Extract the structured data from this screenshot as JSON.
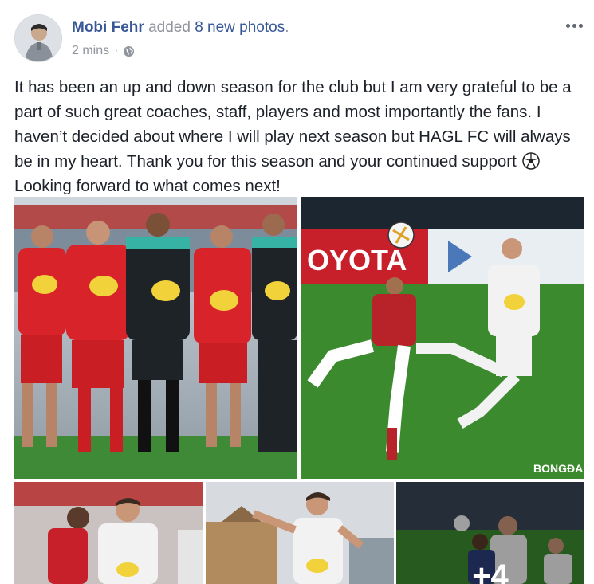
{
  "post": {
    "author": "Mobi Fehr",
    "action": "added",
    "photo_count_text": "8 new photos",
    "timestamp": "2 mins",
    "separator": "·",
    "privacy_icon": "globe-icon",
    "more_icon": "more-options-icon",
    "text_part1": "It has been an up and down season for the club but I am very grateful to be a part of such great coaches, staff, players and most importantly the fans. I haven’t decided about where I will play next season but HAGL FC will always be in my heart. Thank you for this season and your continued support",
    "text_emoji": "soccer-ball-icon",
    "text_part2": "Looking forward to what comes next!"
  },
  "photos": {
    "photo1_icon": "team-group-photo",
    "photo2_icon": "match-action-photo",
    "photo2_watermark": "BONGĐA",
    "photo2_banner": "OYOTA",
    "photo3_icon": "player-photo",
    "photo4_icon": "player-celebration-photo",
    "photo5_icon": "match-photo",
    "more_count": "+4"
  },
  "colors": {
    "link": "#385898",
    "meta": "#90949c",
    "text": "#1d2129",
    "jersey_red": "#d8232a",
    "jersey_white": "#f2f2f2",
    "pitch_green": "#3c8a2e"
  }
}
